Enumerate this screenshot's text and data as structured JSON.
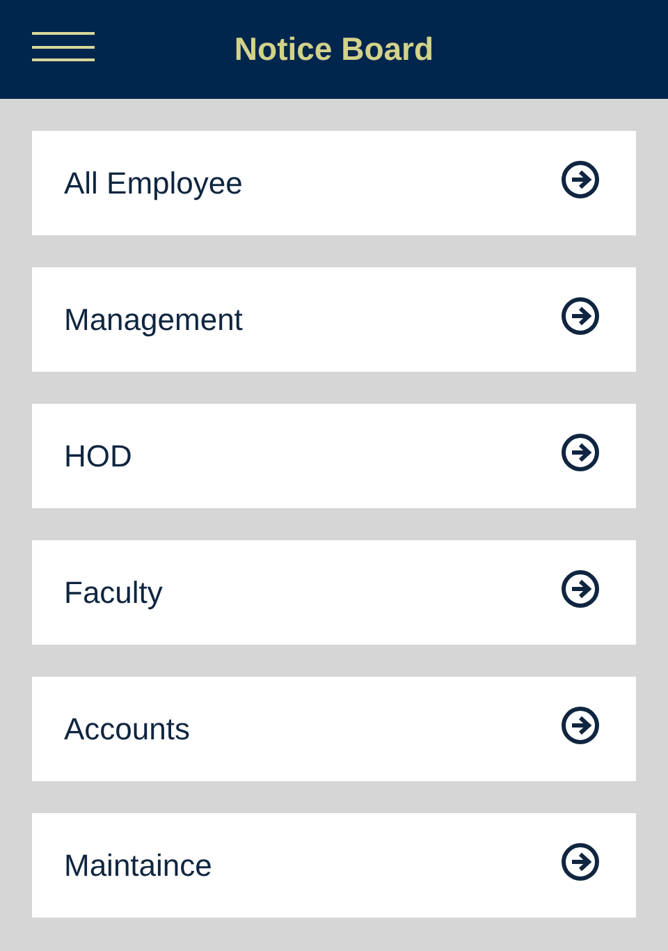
{
  "header": {
    "title": "Notice Board"
  },
  "items": [
    {
      "label": "All Employee"
    },
    {
      "label": "Management"
    },
    {
      "label": "HOD"
    },
    {
      "label": "Faculty"
    },
    {
      "label": "Accounts"
    },
    {
      "label": "Maintaince"
    }
  ]
}
